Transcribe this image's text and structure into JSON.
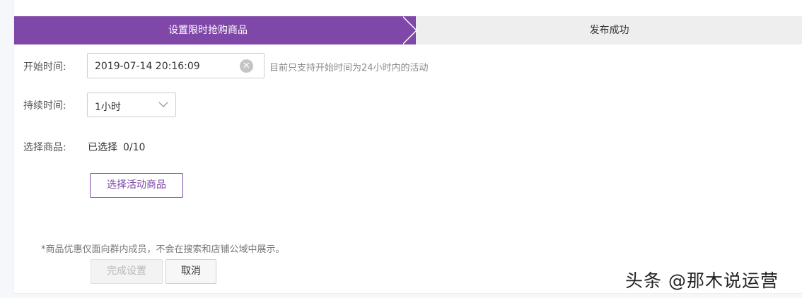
{
  "steps": {
    "active_label": "设置限时抢购商品",
    "next_label": "发布成功"
  },
  "form": {
    "start_time": {
      "label": "开始时间:",
      "value": "2019-07-14 20:16:09",
      "hint": "目前只支持开始时间为24小时内的活动"
    },
    "duration": {
      "label": "持续时间:",
      "selected": "1小时"
    },
    "products": {
      "label": "选择商品:",
      "selected_text": "已选择",
      "count": "0/10",
      "button_label": "选择活动商品"
    }
  },
  "notice": "*商品优惠仅面向群内成员，不会在搜索和店铺公域中展示。",
  "actions": {
    "done_label": "完成设置",
    "cancel_label": "取消"
  },
  "watermark": "头条 @那木说运营",
  "colors": {
    "accent": "#7e47a8",
    "step_inactive_bg": "#eeeeef"
  },
  "icons": {
    "clear": "clear-circle-icon",
    "dropdown": "chevron-down-icon"
  }
}
